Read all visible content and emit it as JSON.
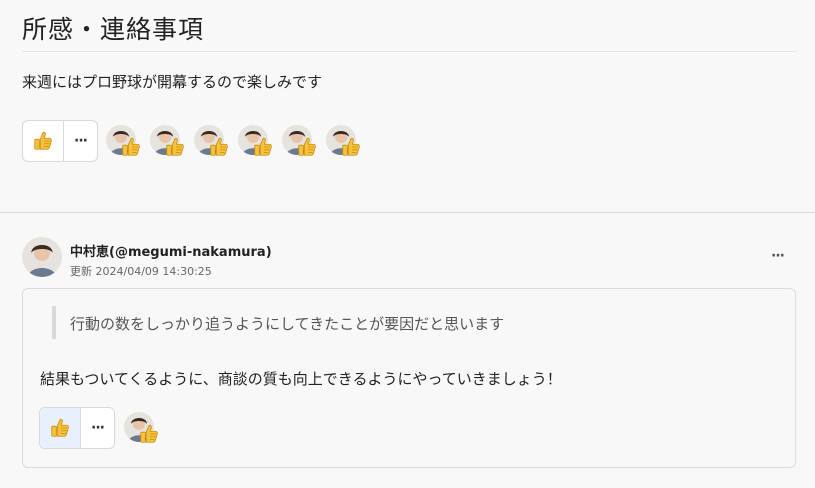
{
  "section": {
    "title": "所感・連絡事項",
    "body": "来週にはプロ野球が開幕するので楽しみです"
  },
  "reactions": {
    "like_icon": "thumbs-up-icon",
    "more_label": "···",
    "reactor_count": 6
  },
  "comment": {
    "author": "中村恵(@megumi-nakamura)",
    "meta": "更新 2024/04/09 14:30:25",
    "menu_label": "···",
    "quote": "行動の数をしっかり追うようにしてきたことが要因だと思います",
    "text": "結果もついてくるように、商談の質も向上できるようにやっていきましょう！",
    "reactions": {
      "more_label": "···",
      "reactor_count": 1
    }
  },
  "colors": {
    "accent_like_bg": "#e8f1fb",
    "thumb": "#f5c33b"
  }
}
